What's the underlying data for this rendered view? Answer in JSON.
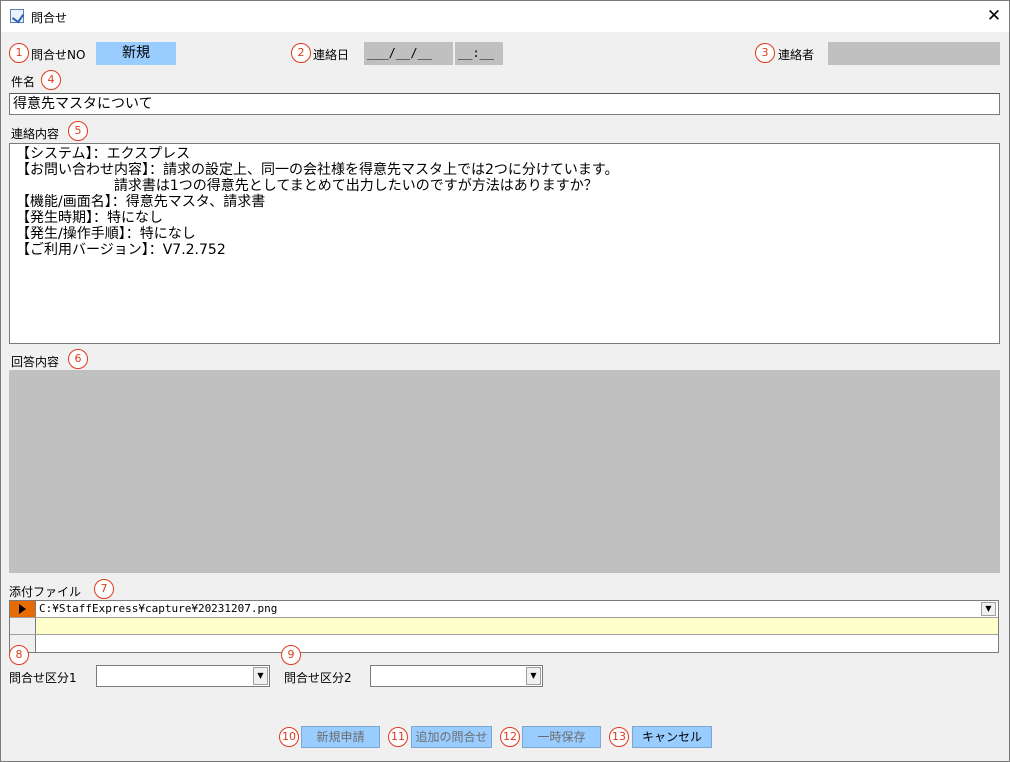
{
  "window": {
    "title": "問合せ",
    "close_glyph": "✕"
  },
  "header": {
    "inquiry_no_label": "問合せNO",
    "inquiry_no_value": "新規",
    "contact_date_label": "連絡日",
    "contact_date_value": "___/__/__",
    "contact_time_value": "__:__",
    "contact_person_label": "連絡者",
    "contact_person_value": ""
  },
  "subject": {
    "label": "件名",
    "value": "得意先マスタについて"
  },
  "contact_content": {
    "label": "連絡内容",
    "lines": [
      "【システム】：エクスプレス",
      "【お問い合わせ内容】：請求の設定上、同一の会社様を得意先マスタ上では2つに分けています。",
      "                      請求書は1つの得意先としてまとめて出力したいのですが方法はありますか？",
      "【機能/画面名】：得意先マスタ、請求書",
      "【発生時期】：特になし",
      "【発生/操作手順】：特になし",
      "【ご利用バージョン】：V7.2.752"
    ]
  },
  "answer_content": {
    "label": "回答内容",
    "value": ""
  },
  "attachments": {
    "label": "添付ファイル",
    "rows": [
      "C:¥StaffExpress¥capture¥20231207.png",
      "",
      ""
    ]
  },
  "categories": {
    "category1_label": "問合せ区分1",
    "category1_value": "",
    "category2_label": "問合せ区分2",
    "category2_value": ""
  },
  "buttons": {
    "new_request": "新規申請",
    "additional_inquiry": "追加の問合せ",
    "temp_save": "一時保存",
    "cancel": "キャンセル"
  },
  "badges": [
    "1",
    "2",
    "3",
    "4",
    "5",
    "6",
    "7",
    "8",
    "9",
    "10",
    "11",
    "12",
    "13"
  ],
  "colors": {
    "badge": "#e03a1e",
    "button_bg": "#99ccff",
    "readonly_bg": "#c0c0c0",
    "highlight_row": "#ffffcc",
    "row_marker": "#e66b00"
  }
}
